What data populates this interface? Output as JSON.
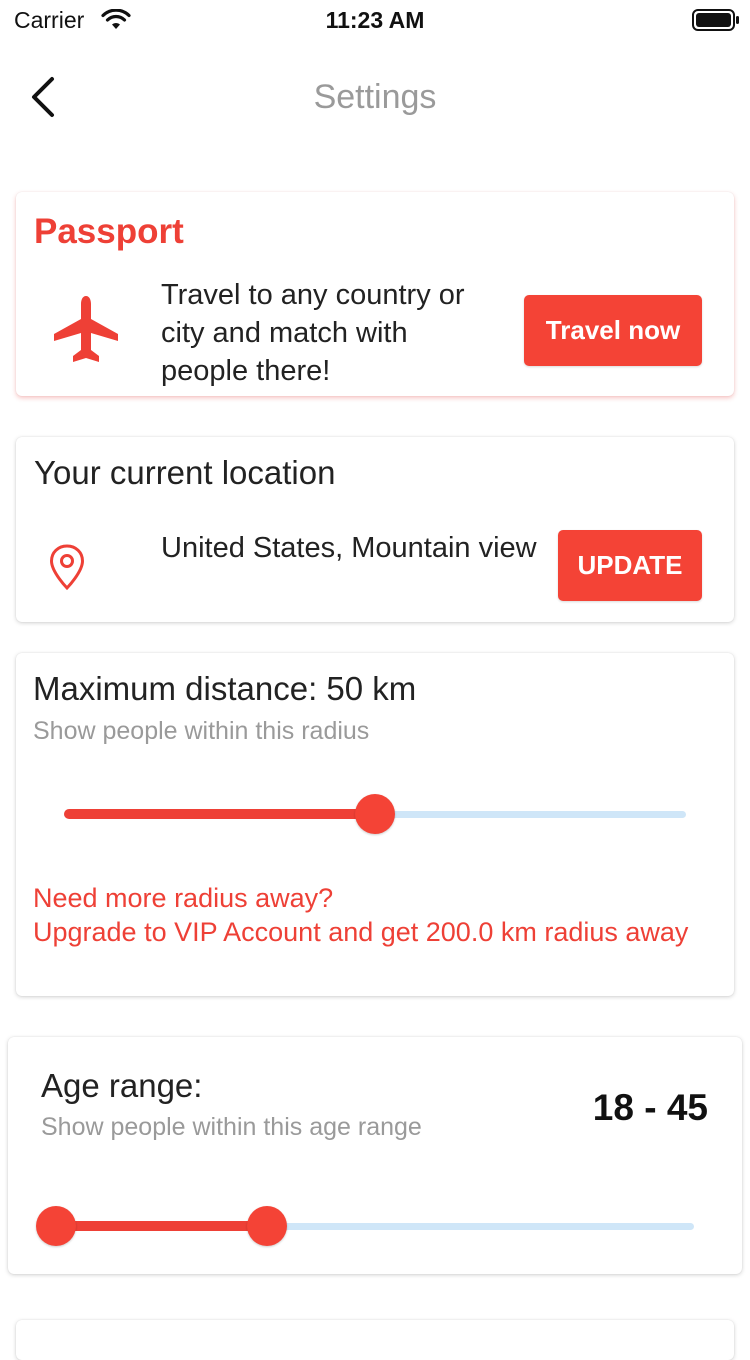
{
  "status_bar": {
    "carrier": "Carrier",
    "time": "11:23 AM"
  },
  "nav": {
    "title": "Settings"
  },
  "passport": {
    "title": "Passport",
    "description": "Travel to any country or city and match with people there!",
    "button": "Travel now"
  },
  "location": {
    "title": "Your current location",
    "value": "United States, Mountain view",
    "button": "UPDATE"
  },
  "distance": {
    "title": "Maximum distance: 50 km",
    "subtitle": "Show people within this radius",
    "slider_value_fraction": 0.5,
    "upsell_line1": "Need more radius away?",
    "upsell_line2": "Upgrade to VIP Account and get 200.0 km radius away"
  },
  "age": {
    "title": "Age range:",
    "subtitle": "Show people within this age range",
    "value": "18 - 45",
    "range_low_fraction": 0.0,
    "range_high_fraction": 0.33
  },
  "colors": {
    "accent": "#f44336",
    "track_inactive": "#cfe6f8",
    "title_muted": "#9a9a9a"
  },
  "icons": [
    "wifi-icon",
    "battery-icon",
    "back-chevron-icon",
    "plane-icon",
    "location-pin-icon"
  ]
}
